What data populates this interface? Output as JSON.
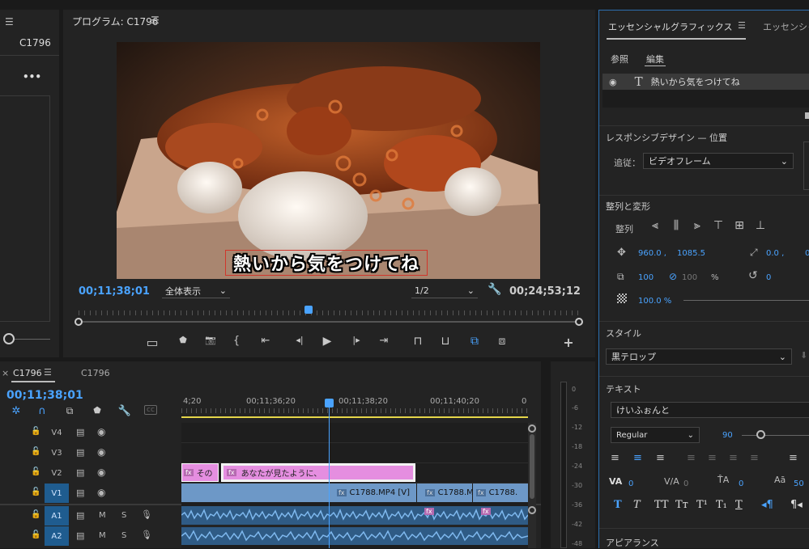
{
  "source_panel": {
    "menu_icon": "☰",
    "sequence_name": "C1796",
    "more_icon": "•••"
  },
  "program_monitor": {
    "title": "プログラム: C1796",
    "menu_icon": "☰",
    "subtitle": "熱いから気をつけてね",
    "current_timecode": "00;11;38;01",
    "zoom": "全体表示",
    "resolution": "1/2",
    "duration": "00;24;53;12",
    "controls": [
      {
        "name": "safe-margins-icon",
        "glyph": "▭"
      },
      {
        "name": "marker-icon",
        "glyph": "⬟"
      },
      {
        "name": "camera-icon",
        "glyph": "📷"
      },
      {
        "name": "mark-in-icon",
        "glyph": "{"
      },
      {
        "name": "go-to-in-icon",
        "glyph": "⇤"
      },
      {
        "name": "step-back-icon",
        "glyph": "◂|"
      },
      {
        "name": "play-icon",
        "glyph": "▶"
      },
      {
        "name": "step-forward-icon",
        "glyph": "|▸"
      },
      {
        "name": "go-to-out-icon",
        "glyph": "⇥"
      },
      {
        "name": "lift-icon",
        "glyph": "⊓"
      },
      {
        "name": "extract-icon",
        "glyph": "⊔"
      },
      {
        "name": "comparison-icon",
        "glyph": "⧉"
      },
      {
        "name": "multi-camera-icon",
        "glyph": "⧈"
      },
      {
        "name": "add-icon",
        "glyph": "+"
      }
    ]
  },
  "timeline": {
    "tab_close": "×",
    "tab_active": "C1796",
    "tab_menu": "☰",
    "tab_other": "C1796",
    "current_timecode": "00;11;38;01",
    "ruler": [
      "4;20",
      "00;11;36;20",
      "00;11;38;20",
      "00;11;40;20",
      "0"
    ],
    "tracks": [
      {
        "label": "V4",
        "type": "video"
      },
      {
        "label": "V3",
        "type": "video"
      },
      {
        "label": "V2",
        "type": "video"
      },
      {
        "label": "V1",
        "type": "video",
        "active": true
      },
      {
        "label": "A1",
        "type": "audio",
        "active": true,
        "m": "M",
        "s": "S"
      },
      {
        "label": "A2",
        "type": "audio",
        "active": true,
        "m": "M",
        "s": "S"
      }
    ],
    "clips": {
      "v2_a": "その",
      "v2_b": "あなたが見たように、",
      "v1_a": "C1788.MP4 [V]",
      "v1_b": "C1788.M",
      "v1_c": "C1788.",
      "fx": "fx"
    },
    "meter_ticks": [
      "0",
      "-6",
      "-12",
      "-18",
      "-24",
      "-30",
      "-36",
      "-42",
      "-48"
    ]
  },
  "essential_graphics": {
    "tab_active": "エッセンシャルグラフィックス",
    "tab_menu": "☰",
    "tab_other": "エッセンシャ",
    "sub_tabs": [
      "参照",
      "編集"
    ],
    "layer_name": "熱いから気をつけてね",
    "responsive_title": "レスポンシブデザイン — 位置",
    "follow_label": "追従：",
    "follow_value": "ビデオフレーム",
    "align_title": "整列と変形",
    "align_label": "整列",
    "pos_x": "960.0 ,",
    "pos_y": "1085.5",
    "anchor_x": "0.0 ,",
    "anchor_y": "0",
    "scale": "100",
    "scale_h": "100",
    "scale_unit": "%",
    "rotation": "0",
    "opacity": "100.0 %",
    "style_title": "スタイル",
    "style_value": "黒テロップ",
    "text_title": "テキスト",
    "font_name": "けいふぉんと",
    "font_style": "Regular",
    "font_size": "90",
    "kerning": "0",
    "tracking": "0",
    "leading": "0",
    "baseline": "50",
    "appearance_title": "アピアランス",
    "text_styles": [
      "T",
      "T",
      "TT",
      "Tт",
      "T¹",
      "T₁",
      "T"
    ]
  }
}
